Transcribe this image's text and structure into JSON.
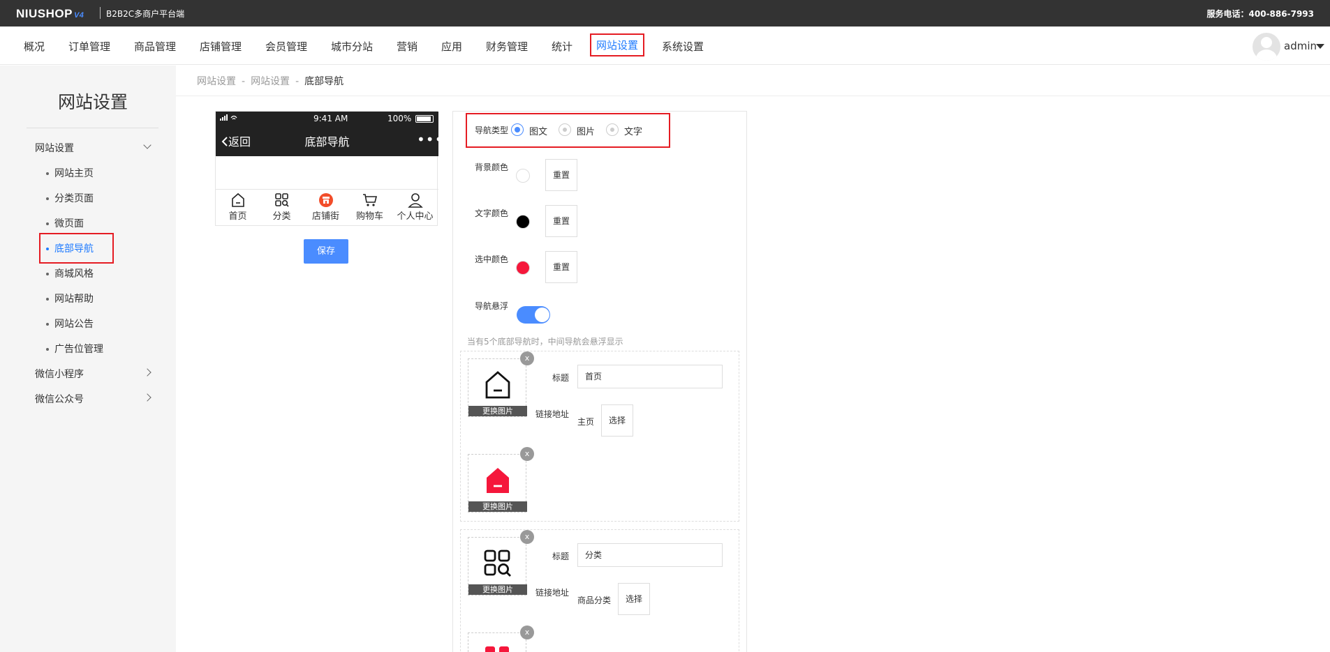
{
  "header": {
    "logo": "NIUSHOP",
    "logo_version": "V4",
    "subtitle": "B2B2C多商户平台端",
    "hotline": "服务电话：400-886-7993"
  },
  "nav": {
    "items": [
      "概况",
      "订单管理",
      "商品管理",
      "店铺管理",
      "会员管理",
      "城市分站",
      "营销",
      "应用",
      "财务管理",
      "统计",
      "网站设置",
      "系统设置"
    ],
    "active": "网站设置",
    "user": "admin"
  },
  "sidebar": {
    "title": "网站设置",
    "group1": "网站设置",
    "subitems": [
      "网站主页",
      "分类页面",
      "微页面",
      "底部导航",
      "商城风格",
      "网站帮助",
      "网站公告",
      "广告位管理"
    ],
    "active_sub": "底部导航",
    "group2": "微信小程序",
    "group3": "微信公众号"
  },
  "breadcrumb": [
    "网站设置",
    "网站设置",
    "底部导航"
  ],
  "breadcrumb_sep": "-",
  "phone": {
    "time": "9:41 AM",
    "battery": "100%",
    "back": "返回",
    "title": "底部导航",
    "more": "•••",
    "tabs": [
      "首页",
      "分类",
      "店铺街",
      "购物车",
      "个人中心"
    ]
  },
  "save_label": "保存",
  "form": {
    "nav_type_label": "导航类型",
    "nav_type_options": [
      "图文",
      "图片",
      "文字"
    ],
    "nav_type_selected": "图文",
    "bg_color_label": "背景颜色",
    "text_color_label": "文字颜色",
    "selected_color_label": "选中颜色",
    "reset_label": "重置",
    "colors": {
      "bg": "#ffffff",
      "text": "#000000",
      "selected": "#f5173b"
    },
    "float_label": "导航悬浮",
    "float_on": true,
    "float_note": "当有5个底部导航时，中间导航会悬浮显示",
    "change_img_label": "更换图片",
    "delete_label": "x",
    "title_label": "标题",
    "link_label": "链接地址",
    "select_label": "选择",
    "items": [
      {
        "title": "首页",
        "link": "主页",
        "icon": "home-icon"
      },
      {
        "title": "分类",
        "link": "商品分类",
        "icon": "category-icon"
      }
    ]
  },
  "accent": "#4a8cff",
  "highlight": "#e51c23"
}
